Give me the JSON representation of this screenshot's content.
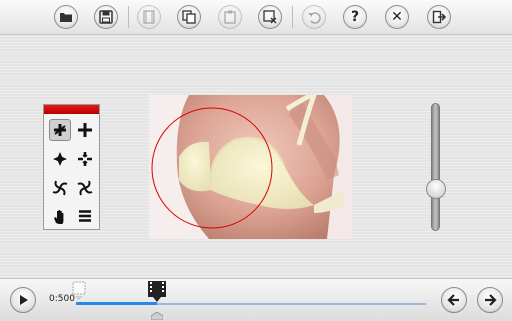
{
  "toolbar": {
    "buttons": [
      {
        "id": "open",
        "icon": "folder-icon"
      },
      {
        "id": "save",
        "icon": "floppy-disk-icon"
      },
      {
        "id": "frames",
        "icon": "film-frames-icon",
        "disabled": true
      },
      {
        "id": "duplicate",
        "icon": "copy-frames-icon"
      },
      {
        "id": "paste",
        "icon": "paste-icon",
        "disabled": true
      },
      {
        "id": "delete",
        "icon": "delete-frame-icon"
      },
      {
        "id": "undo",
        "icon": "undo-icon",
        "disabled": true
      },
      {
        "id": "help",
        "icon": "help-icon",
        "label": "?"
      },
      {
        "id": "close",
        "icon": "close-icon",
        "label": "✕"
      },
      {
        "id": "exit",
        "icon": "exit-icon"
      }
    ]
  },
  "palette": {
    "accent": "#d40000",
    "tools": [
      {
        "name": "rotate-tool-icon",
        "selected": true
      },
      {
        "name": "move-tool-icon"
      },
      {
        "name": "pinch-tool-icon"
      },
      {
        "name": "bloat-tool-icon"
      },
      {
        "name": "twirl-left-tool-icon"
      },
      {
        "name": "twirl-right-tool-icon"
      },
      {
        "name": "hand-tool-icon"
      },
      {
        "name": "menu-icon"
      }
    ]
  },
  "canvas": {
    "brush_color": "#d90000"
  },
  "brush_size_slider": {
    "level": 0.3
  },
  "timeline": {
    "time_label": "0:500",
    "progress": 0.23,
    "accent": "#2b87e6"
  }
}
